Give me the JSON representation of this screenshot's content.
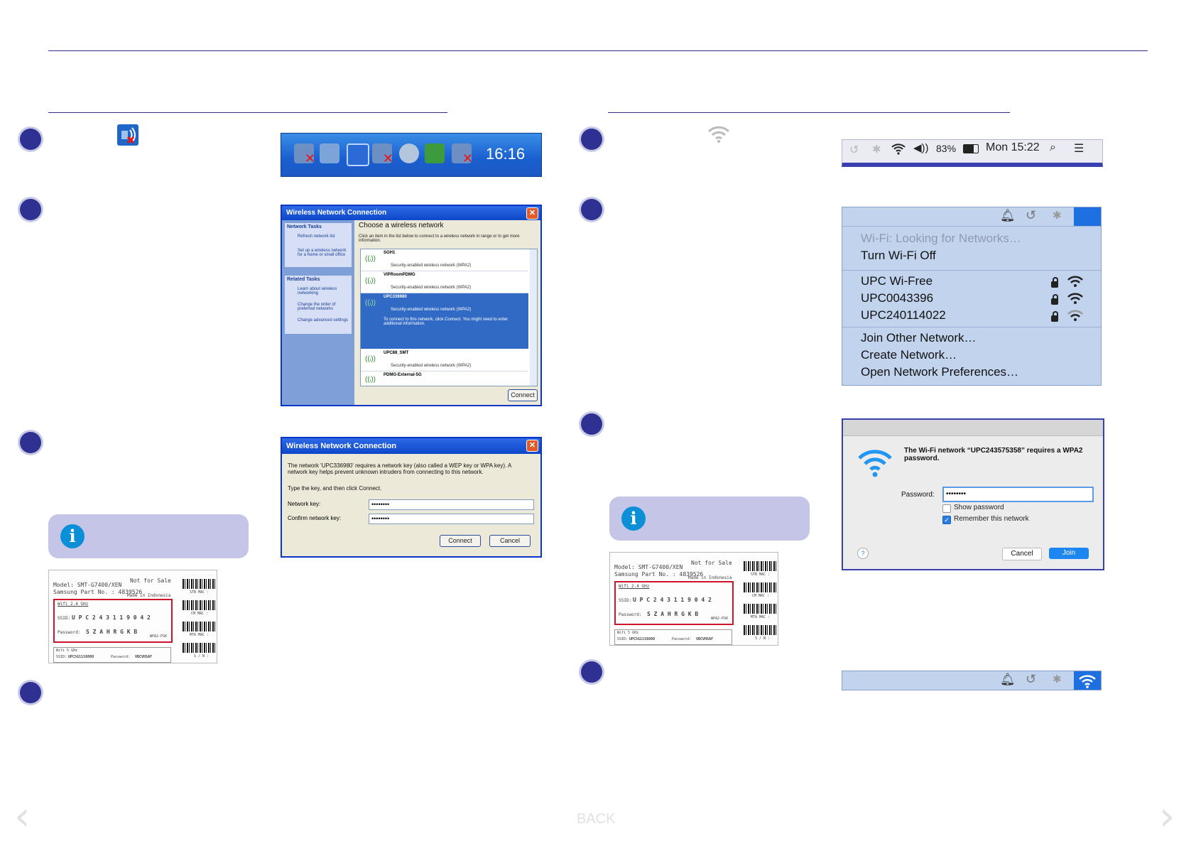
{
  "footer": {
    "back_label": "BACK"
  },
  "left": {
    "taskbar": {
      "time": "16:16"
    },
    "choose_network_window": {
      "title": "Wireless Network Connection",
      "heading": "Choose a wireless network",
      "instructions": "Click an item in the list below to connect to a wireless network in range or to get more information.",
      "network_tasks_header": "Network Tasks",
      "network_tasks": [
        "Refresh network list",
        "Set up a wireless network for a home or small office"
      ],
      "related_tasks_header": "Related Tasks",
      "related_tasks": [
        "Learn about wireless networking",
        "Change the order of preferred networks",
        "Change advanced settings"
      ],
      "networks": [
        {
          "name": "SGH1",
          "security": "Security-enabled wireless network (WPA2)"
        },
        {
          "name": "VIPRoomPDMG",
          "security": "Security-enabled wireless network (WPA2)"
        },
        {
          "name": "UPC336980",
          "security": "Security-enabled wireless network (WPA2)",
          "note": "To connect to this network, click Connect. You might need to enter additional information."
        },
        {
          "name": "UPC88_SMT",
          "security": "Security-enabled wireless network (WPA2)"
        },
        {
          "name": "PDMG-External-5G",
          "security": ""
        }
      ],
      "connect_label": "Connect"
    },
    "key_dialog": {
      "title": "Wireless Network Connection",
      "message": "The network 'UPC336980' requires a network key (also called a WEP key or WPA key). A network key helps prevent unknown intruders from connecting to this network.",
      "prompt": "Type the key, and then click Connect.",
      "network_key_label": "Network key:",
      "confirm_key_label": "Confirm network key:",
      "network_key_value": "••••••••",
      "confirm_key_value": "••••••••",
      "connect_label": "Connect",
      "cancel_label": "Cancel"
    },
    "label": {
      "model": "Model: SMT-G7400/XEN",
      "part_no": "Samsung Part No. : 4839526",
      "not_for_sale": "Not for Sale",
      "made_in": "Made in Indonesia",
      "wifi_header": "Wifi 2.4 GHz",
      "ssid_label": "SSID:",
      "ssid_value": "U P C 2 4 3 1 1 9 0 4 2",
      "password_label": "Password:",
      "password_value": "S Z A H R G K B",
      "wpa_tag": "WPA2-PSK",
      "wifi5_header": "Wifi 5 GHz",
      "ssid5_label": "SSID:",
      "ssid5_value": "UPC5G1158808",
      "password5_label": "Password:",
      "password5_value": "VBCVHSAF",
      "stb_mac": "STB MAC :",
      "cm_mac": "CM MAC :",
      "mta_mac": "MTA MAC :",
      "sn": "S / N :"
    }
  },
  "right": {
    "menubar": {
      "battery": "83%",
      "clock": "Mon 15:22"
    },
    "wifi_menu": {
      "status": "Wi-Fi: Looking for Networks…",
      "toggle": "Turn Wi-Fi Off",
      "networks": [
        "UPC Wi-Free",
        "UPC0043396",
        "UPC240114022"
      ],
      "actions": [
        "Join Other Network…",
        "Create Network…",
        "Open Network Preferences…"
      ]
    },
    "password_dialog": {
      "message": "The Wi-Fi network “UPC243575358” requires a WPA2 password.",
      "password_label": "Password:",
      "password_value": "••••••••",
      "show_password": "Show password",
      "remember": "Remember this network",
      "help": "?",
      "cancel_label": "Cancel",
      "join_label": "Join"
    },
    "label": {
      "model": "Model: SMT-G7400/XEN",
      "part_no": "Samsung Part No. : 4839526",
      "not_for_sale": "Not for Sale",
      "made_in": "Made in Indonesia",
      "wifi_header": "Wifi 2.4 GHz",
      "ssid_label": "SSID:",
      "ssid_value": "U P C 2 4 3 1 1 9 0 4 2",
      "password_label": "Password:",
      "password_value": "S Z A H R G K B",
      "wpa_tag": "WPA2-PSK",
      "wifi5_header": "Wifi 5 GHz",
      "ssid5_label": "SSID:",
      "ssid5_value": "UPC5G1158808",
      "password5_label": "Password:",
      "password5_value": "VBCVHSAF",
      "stb_mac": "STB MAC :",
      "cm_mac": "CM MAC :",
      "mta_mac": "MTA MAC :",
      "sn": "S / N :"
    }
  }
}
